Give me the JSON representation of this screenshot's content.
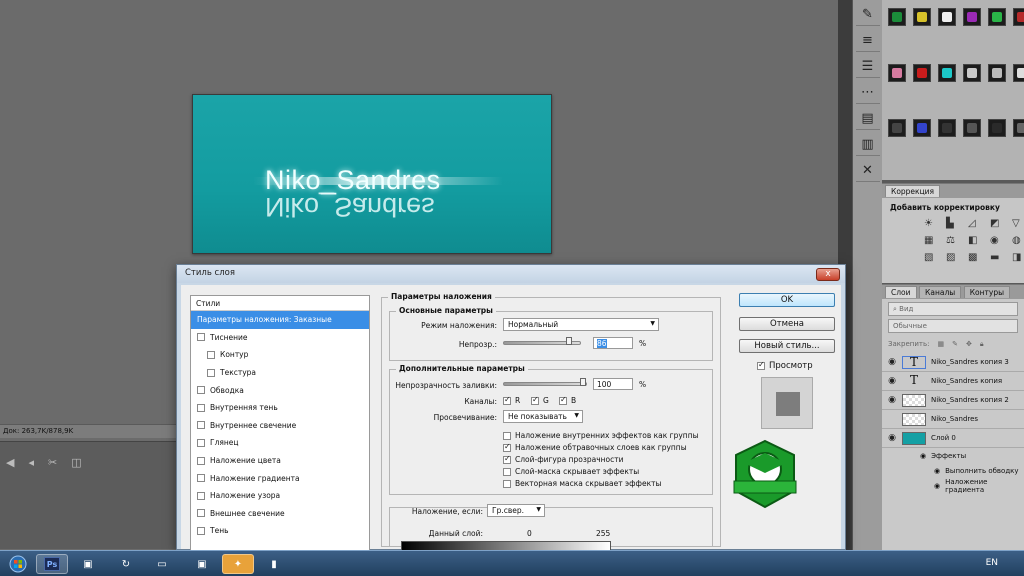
{
  "document": {
    "canvas_text": "Niko_Sandres",
    "status": "Док: 263,7K/878,9K"
  },
  "dialog": {
    "title": "Стиль слоя",
    "close_glyph": "x",
    "styles_header": "Стили",
    "styles": [
      {
        "label": "Параметры наложения: Заказные",
        "selected": true,
        "checkbox": false,
        "sub": false
      },
      {
        "label": "Тиснение",
        "checkbox": true,
        "sub": false
      },
      {
        "label": "Контур",
        "checkbox": true,
        "sub": true
      },
      {
        "label": "Текстура",
        "checkbox": true,
        "sub": true
      },
      {
        "label": "Обводка",
        "checkbox": true,
        "sub": false
      },
      {
        "label": "Внутренняя тень",
        "checkbox": true,
        "sub": false
      },
      {
        "label": "Внутреннее свечение",
        "checkbox": true,
        "sub": false
      },
      {
        "label": "Глянец",
        "checkbox": true,
        "sub": false
      },
      {
        "label": "Наложение цвета",
        "checkbox": true,
        "sub": false
      },
      {
        "label": "Наложение градиента",
        "checkbox": true,
        "sub": false
      },
      {
        "label": "Наложение узора",
        "checkbox": true,
        "sub": false
      },
      {
        "label": "Внешнее свечение",
        "checkbox": true,
        "sub": false
      },
      {
        "label": "Тень",
        "checkbox": true,
        "sub": false
      }
    ],
    "blend_section": "Параметры наложения",
    "basic_section": "Основные параметры",
    "blend_mode_label": "Режим наложения:",
    "blend_mode_value": "Нормальный",
    "opacity_label": "Непрозр.:",
    "opacity_value": "86",
    "opacity_fraction": 0.86,
    "percent": "%",
    "advanced_section": "Дополнительные параметры",
    "fill_label": "Непрозрачность заливки:",
    "fill_value": "100",
    "fill_fraction": 1.0,
    "channels_label": "Каналы:",
    "channel_r": "R",
    "channel_g": "G",
    "channel_b": "B",
    "knockout_label": "Просвечивание:",
    "knockout_value": "Не показывать",
    "options": [
      {
        "label": "Наложение внутренних эффектов как группы",
        "checked": false
      },
      {
        "label": "Наложение обтравочных слоев как группы",
        "checked": true
      },
      {
        "label": "Слой-фигура прозрачности",
        "checked": true
      },
      {
        "label": "Слой-маска скрывает эффекты",
        "checked": false
      },
      {
        "label": "Векторная маска скрывает эффекты",
        "checked": false
      }
    ],
    "blend_if_label": "Наложение, если:",
    "blend_if_value": "Гр.свер.",
    "this_layer_label": "Данный слой:",
    "this_layer_min": "0",
    "this_layer_max": "255",
    "ok": "OK",
    "cancel": "Отмена",
    "new_style": "Новый стиль...",
    "preview_label": "Просмотр",
    "preview_checked": true
  },
  "corrections": {
    "tab": "Коррекция",
    "title": "Добавить корректировку",
    "icons": [
      "brightness-icon",
      "levels-icon",
      "curves-icon",
      "exposure-icon",
      "triangle-icon",
      "hsl-icon",
      "balance-icon",
      "bw-icon",
      "photo-filter-icon",
      "mixer-icon",
      "invert-icon",
      "posterize-icon",
      "threshold-icon",
      "gradient-map-icon",
      "selective-color-icon"
    ]
  },
  "layers_panel": {
    "tabs": [
      "Слои",
      "Каналы",
      "Контуры"
    ],
    "kind_filter": "Вид",
    "blend_mode": "Обычные",
    "lock_label": "Закрепить:",
    "layers": [
      {
        "name": "Niko_Sandres копия 3",
        "thumb": "T",
        "selected": true
      },
      {
        "name": "Niko_Sandres копия",
        "thumb": "T"
      },
      {
        "name": "Niko_Sandres копия 2",
        "thumb": ""
      },
      {
        "name": "Niko_Sandres",
        "thumb": ""
      },
      {
        "name": "Слой 0",
        "thumb": ""
      }
    ],
    "effects_label": "Эффекты",
    "effect_1": "Выполнить обводку",
    "effect_2": "Наложение градиента"
  },
  "taskbar": {
    "lang": "EN",
    "ps_label": "Ps"
  },
  "colors": {
    "accent": "#3a8ee6",
    "canvas_teal": "#1ba4a8",
    "dialog_frame": "#c8d7e6"
  }
}
